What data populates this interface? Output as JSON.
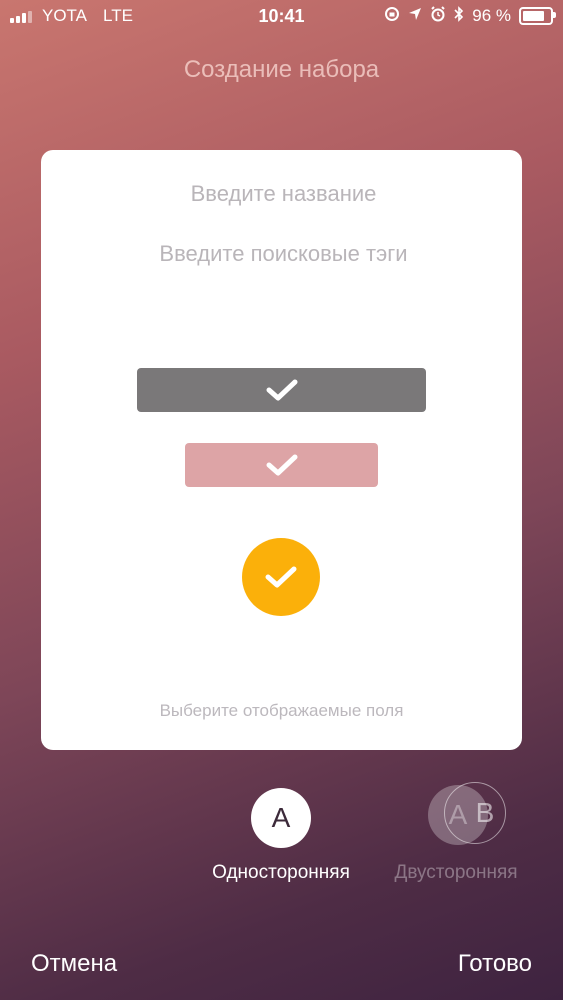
{
  "status_bar": {
    "carrier": "YOTA",
    "network": "LTE",
    "time": "10:41",
    "battery_percent": "96 %",
    "battery_level": 0.96,
    "icons": [
      "signal-icon",
      "screen-rotation-lock-icon",
      "location-arrow-icon",
      "alarm-icon",
      "bluetooth-icon",
      "battery-icon"
    ]
  },
  "header": {
    "title": "Создание набора"
  },
  "card": {
    "name_placeholder": "Введите название",
    "tags_placeholder": "Введите поисковые тэги",
    "fields_label": "Выберите отображаемые поля"
  },
  "colors": {
    "option_dark": "#7a7879",
    "option_pink": "#dda4a6",
    "option_circle": "#fbb00a"
  },
  "modes": {
    "single": {
      "icon_letter": "A",
      "label": "Односторонняя",
      "selected": true
    },
    "double": {
      "icon_letter_a": "A",
      "icon_letter_b": "B",
      "label": "Двусторонняя",
      "selected": false
    }
  },
  "footer": {
    "cancel": "Отмена",
    "done": "Готово"
  }
}
